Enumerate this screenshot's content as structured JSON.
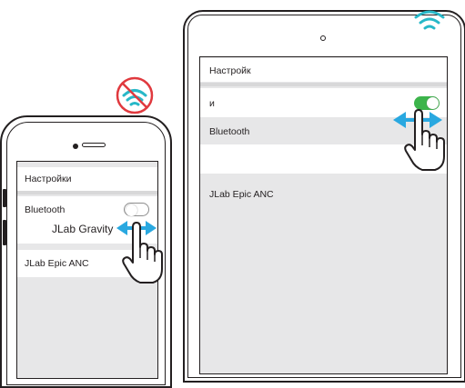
{
  "phone": {
    "header": "Настройки",
    "bluetooth_label": "Bluetooth",
    "device_1": "JLab Gravity",
    "device_2": "JLab Epic ANC",
    "toggle_state": "off"
  },
  "tablet": {
    "header": "Настройк",
    "row_1_label": "и",
    "bluetooth_label": "Bluetooth",
    "device_1": "JLab Epic ANC",
    "toggle_state": "on"
  },
  "icons": {
    "phone_signal": "no-signal-icon",
    "tablet_signal": "signal-icon",
    "hand": "hand-pointer-icon",
    "swipe": "swipe-arrows-icon"
  },
  "colors": {
    "toggle_on": "#3cb44b",
    "arrow_blue": "#29a8e0",
    "prohibit_red": "#e0393e",
    "signal_teal": "#27b8c8"
  }
}
